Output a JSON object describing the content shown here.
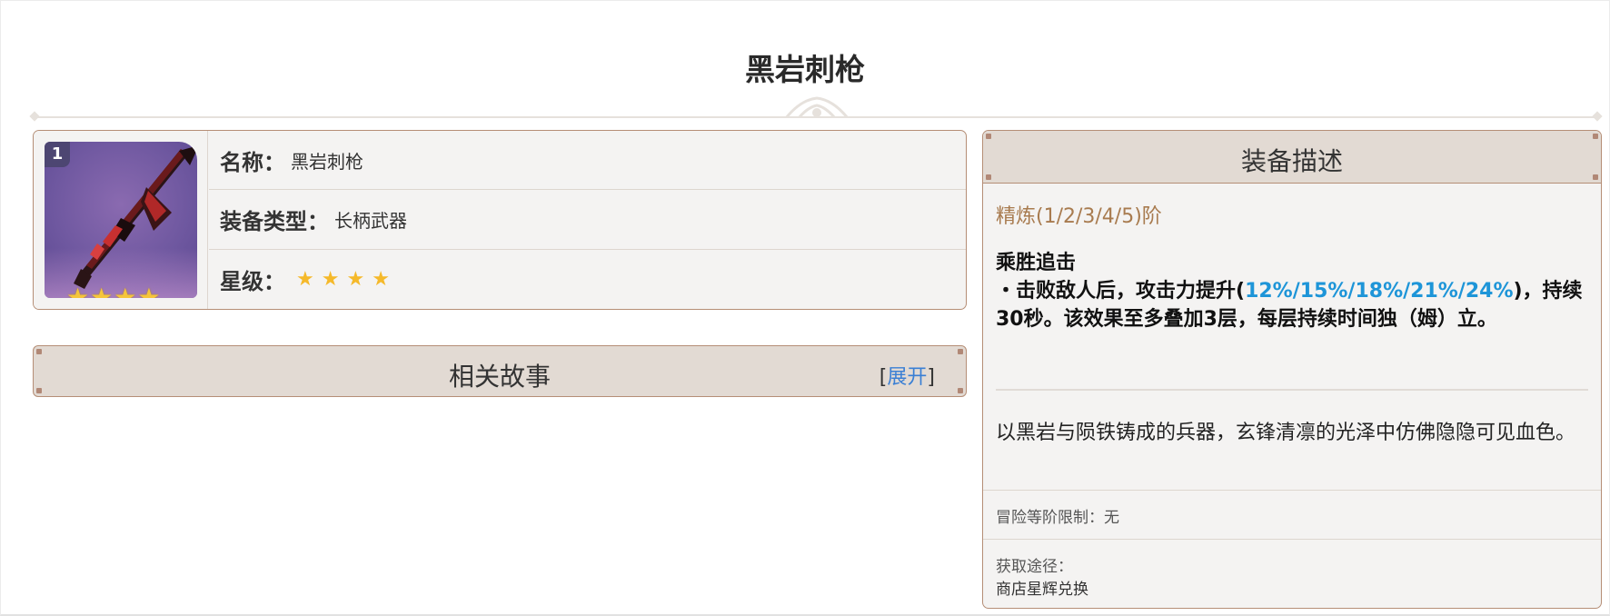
{
  "page": {
    "title": "黑岩刺枪"
  },
  "info": {
    "thumbnail": {
      "level_badge": "1",
      "weapon_icon": "polearm-icon",
      "stars": "★★★★"
    },
    "rows": [
      {
        "label": "名称：",
        "value": "黑岩刺枪"
      },
      {
        "label": "装备类型：",
        "value": "长柄武器"
      },
      {
        "label": "星级：",
        "value": "★★★★"
      }
    ],
    "star_count": 4
  },
  "story": {
    "title": "相关故事",
    "bracket_open": "[",
    "toggle_label": "展开",
    "bracket_close": "]"
  },
  "description": {
    "header": "装备描述",
    "refinement": "精炼(1/2/3/4/5)阶",
    "passive_name": "乘胜追击",
    "passive_text_before": "・击败敌人后，攻击力提升(",
    "passive_highlight": "12%/15%/18%/21%/24%",
    "passive_text_after": ")，持续30秒。该效果至多叠加3层，每层持续时间独（姆）立。",
    "lore": "以黑岩与陨铁铸成的兵器，玄锋清凛的光泽中仿佛隐隐可见血色。",
    "adventure_rank": "冒险等阶限制：无",
    "source_label": "获取途径：",
    "source_value": "商店星辉兑换"
  },
  "colors": {
    "accent_border": "#b58e76",
    "header_bg": "#e2dad3",
    "refine_text": "#a87b4f",
    "highlight_text": "#1e95d8",
    "link": "#3a7fd4",
    "star": "#f5b92a"
  }
}
